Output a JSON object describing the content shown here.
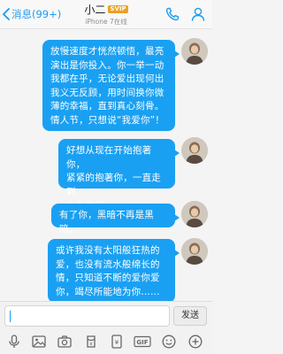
{
  "header": {
    "back_label": "消息(99+)",
    "contact_name": "小二",
    "badge": "SVIP",
    "status": "iPhone 7在线",
    "icons": [
      "chevron-left-icon",
      "phone-icon",
      "person-icon"
    ]
  },
  "messages": [
    {
      "lines": [
        "放慢速度才恍然顿悟，最亮",
        "演出是你投入。你一举一动",
        "我都在乎，无论爱出现何出",
        "我义无反顾，用时间换你微",
        "薄的幸福，直到真心刻骨。",
        "情人节，只想说“我爱你”！"
      ]
    },
    {
      "lines": [
        "好想从现在开始抱著你，",
        "紧紧的抱著你，一直走到",
        "上帝面前…"
      ]
    },
    {
      "lines": [
        "有了你，黑暗不再是黑暗。"
      ]
    },
    {
      "lines": [
        "或许我没有太阳般狂热的",
        "爱，也没有流水般绵长的",
        "情，只知道不断的爱你爱",
        "你，竭尽所能地为你……"
      ]
    }
  ],
  "input": {
    "value": "",
    "send_label": "发送"
  },
  "toolbar": {
    "items": [
      {
        "name": "voice-icon"
      },
      {
        "name": "image-icon"
      },
      {
        "name": "camera-icon"
      },
      {
        "name": "red-packet-icon"
      },
      {
        "name": "gif-icon",
        "label": "GIF"
      },
      {
        "name": "emoji-icon"
      },
      {
        "name": "plus-icon"
      }
    ]
  },
  "colors": {
    "accent": "#1d9bf0",
    "bubble": "#1aa0f2",
    "background": "#f4f4f5",
    "badge": "#f0a020"
  }
}
